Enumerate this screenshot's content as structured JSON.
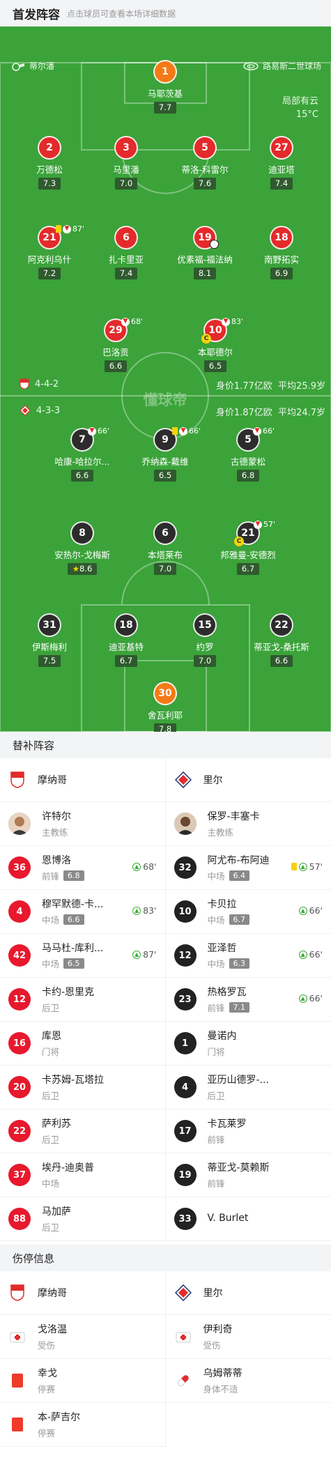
{
  "header": {
    "title": "首发阵容",
    "subtitle": "点击球员可查看本场详细数据"
  },
  "venue": {
    "referee": "蒂尔潘",
    "stadium": "路易斯二世球场"
  },
  "weather": {
    "condition": "局部有云",
    "temp": "15°C"
  },
  "home": {
    "formation": "4-4-2",
    "value": "身价1.77亿欧",
    "age": "平均25.9岁",
    "players": [
      {
        "num": "1",
        "name": "马耶茨基",
        "score": "7.7",
        "color": "orange"
      },
      {
        "num": "2",
        "name": "万德松",
        "score": "7.3",
        "color": "red"
      },
      {
        "num": "3",
        "name": "马里潘",
        "score": "7.0",
        "color": "red"
      },
      {
        "num": "5",
        "name": "蒂洛-科雷尔",
        "score": "7.6",
        "color": "red"
      },
      {
        "num": "27",
        "name": "迪亚塔",
        "score": "7.4",
        "color": "red"
      },
      {
        "num": "21",
        "name": "阿克利乌什",
        "score": "7.2",
        "color": "red",
        "sub": "87'"
      },
      {
        "num": "6",
        "name": "扎卡里亚",
        "score": "7.4",
        "color": "red"
      },
      {
        "num": "19",
        "name": "优素福-福法纳",
        "score": "8.1",
        "color": "red"
      },
      {
        "num": "18",
        "name": "南野拓实",
        "score": "6.9",
        "color": "red"
      },
      {
        "num": "29",
        "name": "巴洛贡",
        "score": "6.6",
        "color": "red",
        "sub": "68'"
      },
      {
        "num": "10",
        "name": "本耶德尔",
        "score": "6.5",
        "color": "red",
        "sub": "83'"
      }
    ]
  },
  "away": {
    "formation": "4-3-3",
    "value": "身价1.87亿欧",
    "age": "平均24.7岁",
    "players": [
      {
        "num": "7",
        "name": "哈康-哈拉尔...",
        "score": "6.6",
        "color": "dark",
        "sub": "66'"
      },
      {
        "num": "9",
        "name": "乔纳森-戴维",
        "score": "6.5",
        "color": "dark",
        "sub": "66'"
      },
      {
        "num": "5",
        "name": "古德蒙松",
        "score": "6.8",
        "color": "dark",
        "sub": "66'"
      },
      {
        "num": "8",
        "name": "安热尔-戈梅斯",
        "score": "8.6",
        "color": "dark"
      },
      {
        "num": "6",
        "name": "本塔莱布",
        "score": "7.0",
        "color": "dark"
      },
      {
        "num": "21",
        "name": "邦雅曼-安德烈",
        "score": "6.7",
        "color": "dark",
        "sub": "57'"
      },
      {
        "num": "31",
        "name": "伊斯梅利",
        "score": "7.5",
        "color": "dark"
      },
      {
        "num": "18",
        "name": "迪亚基特",
        "score": "6.7",
        "color": "dark"
      },
      {
        "num": "15",
        "name": "约罗",
        "score": "7.0",
        "color": "dark"
      },
      {
        "num": "22",
        "name": "蒂亚戈-桑托斯",
        "score": "6.6",
        "color": "dark"
      },
      {
        "num": "30",
        "name": "舍瓦利耶",
        "score": "7.8",
        "color": "orange"
      }
    ]
  },
  "subs_section": {
    "title": "替补阵容",
    "home_team": "摩纳哥",
    "away_team": "里尔",
    "home_coach": {
      "name": "许特尔",
      "role": "主教练"
    },
    "away_coach": {
      "name": "保罗-丰塞卡",
      "role": "主教练"
    },
    "home_subs": [
      {
        "num": "36",
        "name": "恩博洛",
        "pos": "前锋",
        "score": "6.8",
        "in": "68'"
      },
      {
        "num": "4",
        "name": "穆罕默德-卡...",
        "pos": "中场",
        "score": "6.6",
        "in": "83'"
      },
      {
        "num": "42",
        "name": "马马杜-库利...",
        "pos": "中场",
        "score": "6.5",
        "in": "87'"
      },
      {
        "num": "12",
        "name": "卡约-恩里克",
        "pos": "后卫"
      },
      {
        "num": "16",
        "name": "库恩",
        "pos": "门将"
      },
      {
        "num": "20",
        "name": "卡苏姆-瓦塔拉",
        "pos": "后卫"
      },
      {
        "num": "22",
        "name": "萨利苏",
        "pos": "后卫"
      },
      {
        "num": "37",
        "name": "埃丹-迪奥普",
        "pos": "中场"
      },
      {
        "num": "88",
        "name": "马加萨",
        "pos": "后卫"
      }
    ],
    "away_subs": [
      {
        "num": "32",
        "name": "阿尤布-布阿迪",
        "pos": "中场",
        "score": "6.4",
        "in": "57'",
        "yellow": true
      },
      {
        "num": "10",
        "name": "卡贝拉",
        "pos": "中场",
        "score": "6.7",
        "in": "66'"
      },
      {
        "num": "12",
        "name": "亚泽哲",
        "pos": "中场",
        "score": "6.3",
        "in": "66'"
      },
      {
        "num": "23",
        "name": "热格罗瓦",
        "pos": "前锋",
        "score": "7.1",
        "in": "66'"
      },
      {
        "num": "1",
        "name": "曼诺内",
        "pos": "门将"
      },
      {
        "num": "4",
        "name": "亚历山德罗-...",
        "pos": "后卫"
      },
      {
        "num": "17",
        "name": "卡瓦莱罗",
        "pos": "前锋"
      },
      {
        "num": "19",
        "name": "蒂亚戈-莫赖斯",
        "pos": "前锋"
      },
      {
        "num": "33",
        "name": "V. Burlet",
        "pos": ""
      }
    ]
  },
  "injury_section": {
    "title": "伤停信息",
    "home_team": "摩纳哥",
    "away_team": "里尔",
    "home": [
      {
        "name": "戈洛温",
        "status": "受伤",
        "icon": "medkit-icon"
      },
      {
        "name": "幸戈",
        "status": "停赛",
        "icon": "red-card-icon"
      },
      {
        "name": "本-萨吉尔",
        "status": "停赛",
        "icon": "red-card-icon"
      }
    ],
    "away": [
      {
        "name": "伊利奇",
        "status": "受伤",
        "icon": "medkit-icon"
      },
      {
        "name": "乌姆蒂蒂",
        "status": "身体不适",
        "icon": "pill-icon"
      }
    ]
  },
  "watermark": "懂球帝",
  "colors": {
    "pitch": "#3ba33a",
    "red": "#e42a2a",
    "orange": "#f47a16",
    "dark": "#2c2c2c"
  }
}
